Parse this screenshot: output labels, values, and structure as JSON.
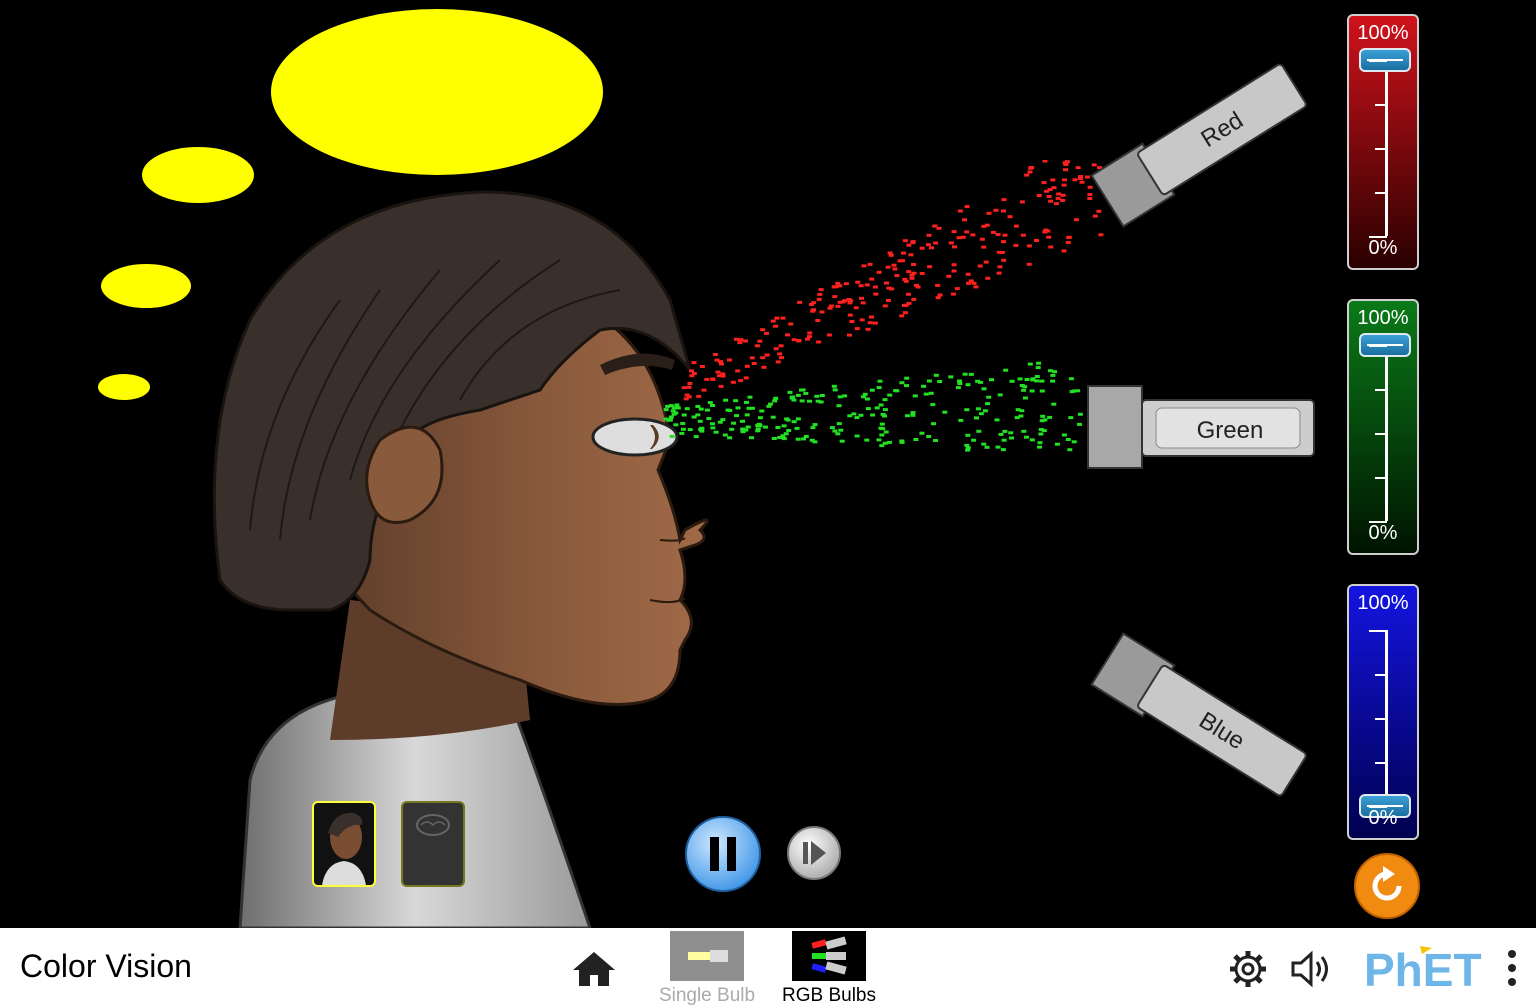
{
  "sim": {
    "title": "Color Vision"
  },
  "flashlights": {
    "red": {
      "label": "Red"
    },
    "green": {
      "label": "Green"
    },
    "blue": {
      "label": "Blue"
    }
  },
  "sliders": {
    "red": {
      "max_label": "100%",
      "min_label": "0%",
      "value_fraction": 1.0,
      "color": "#d0121b"
    },
    "green": {
      "max_label": "100%",
      "min_label": "0%",
      "value_fraction": 1.0,
      "color": "#0a7a18"
    },
    "blue": {
      "max_label": "100%",
      "min_label": "0%",
      "value_fraction": 0.0,
      "color": "#1010d8"
    }
  },
  "perceived_color": "#ffff00",
  "navbar": {
    "screens": [
      {
        "label": "Single Bulb",
        "selected": false
      },
      {
        "label": "RGB Bulbs",
        "selected": true
      }
    ],
    "brand": "PhET"
  },
  "icons": [
    "home-icon",
    "settings-icon",
    "sound-icon",
    "menu-icon",
    "pause-icon",
    "step-icon",
    "reset-icon"
  ]
}
